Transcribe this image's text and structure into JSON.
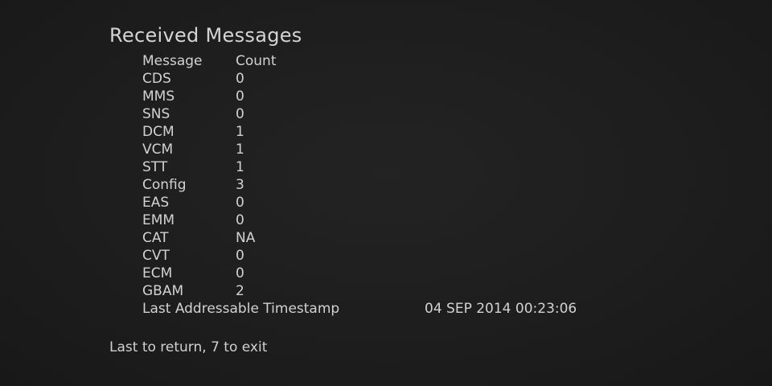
{
  "screen": {
    "title": "Received Messages",
    "table": {
      "header": {
        "col1": "Message",
        "col2": "Count"
      },
      "rows": [
        {
          "name": "CDS",
          "count": "0"
        },
        {
          "name": "MMS",
          "count": "0"
        },
        {
          "name": "SNS",
          "count": "0"
        },
        {
          "name": "DCM",
          "count": "1"
        },
        {
          "name": "VCM",
          "count": "1"
        },
        {
          "name": "STT",
          "count": "1"
        },
        {
          "name": "Config",
          "count": "3"
        },
        {
          "name": "EAS",
          "count": "0"
        },
        {
          "name": "EMM",
          "count": "0"
        },
        {
          "name": "CAT",
          "count": "NA"
        },
        {
          "name": "CVT",
          "count": "0"
        },
        {
          "name": "ECM",
          "count": "0"
        },
        {
          "name": "GBAM",
          "count": "2"
        }
      ],
      "timestamp": {
        "label": "Last Addressable Timestamp",
        "value": "04 SEP 2014 00:23:06"
      }
    },
    "footer": "Last to return, 7 to exit"
  }
}
